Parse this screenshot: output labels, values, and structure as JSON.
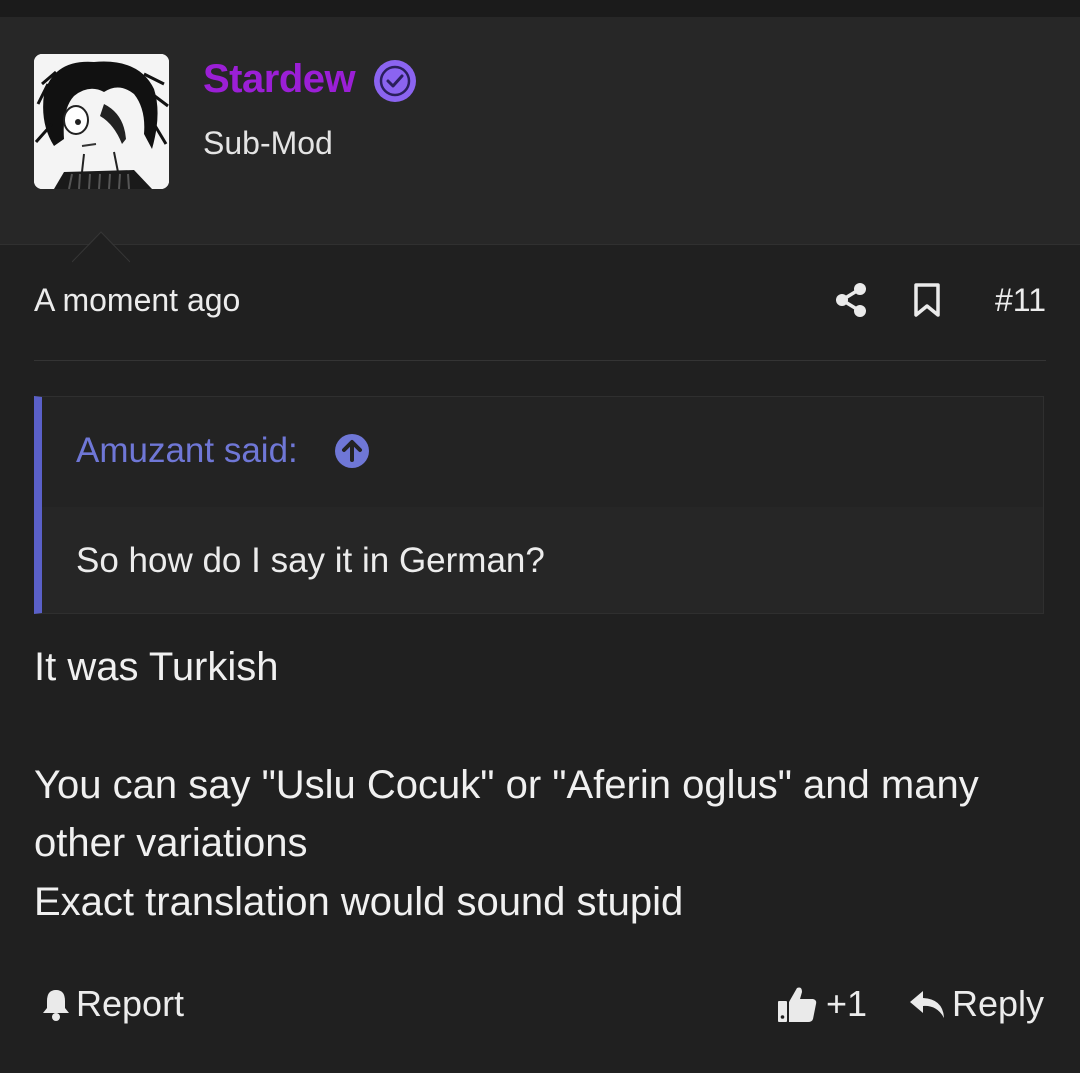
{
  "author": {
    "name": "Stardew",
    "title": "Sub-Mod",
    "name_color": "#9b1fd6",
    "verified": true,
    "avatar": "sketched-character-avatar"
  },
  "post": {
    "timestamp": "A moment ago",
    "number": "#11",
    "share_icon": "share-icon",
    "bookmark_icon": "bookmark-icon"
  },
  "quote": {
    "author_label": "Amuzant said:",
    "text": "So how do I say it in German?",
    "accent_color": "#5a60c8"
  },
  "message": {
    "paragraph1": "It was Turkish",
    "line2": "You can say \"Uslu Cocuk\" or \"Aferin oglus\" and many",
    "line3": "other variations",
    "line4": "Exact translation would sound stupid"
  },
  "actions": {
    "report_label": "Report",
    "like_count": "+1",
    "reply_label": "Reply"
  }
}
